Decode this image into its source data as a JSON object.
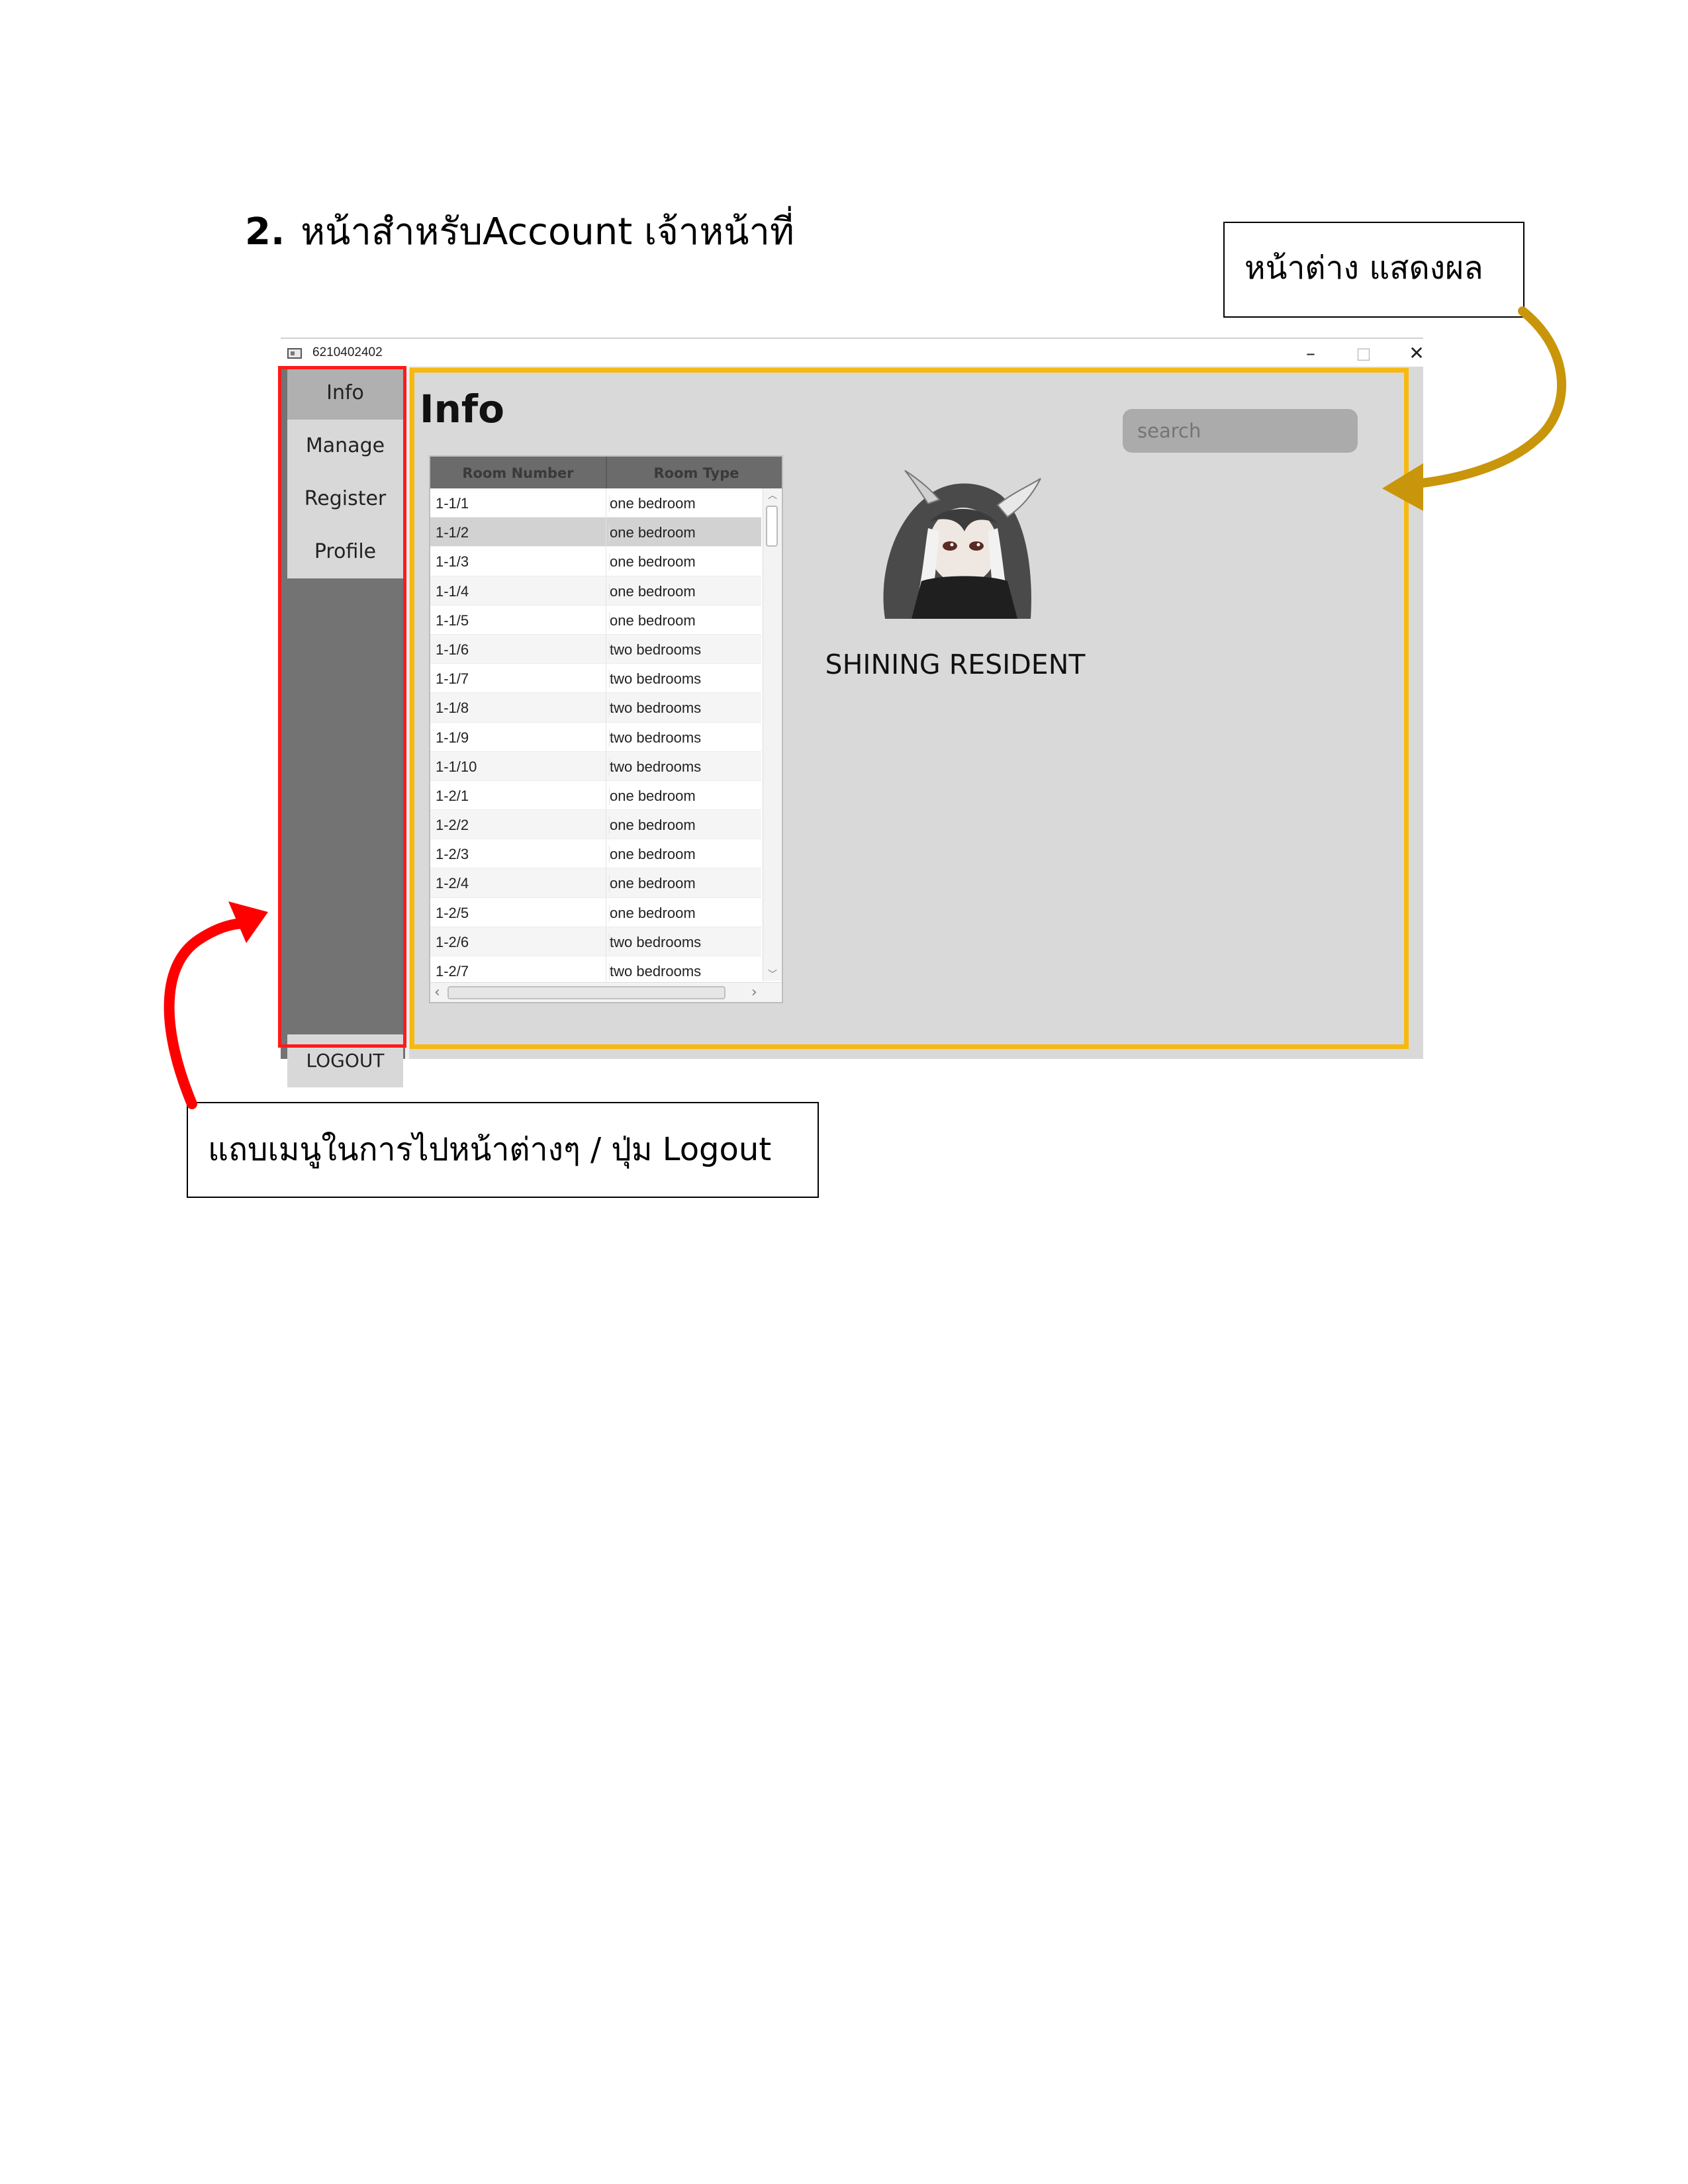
{
  "document": {
    "heading_number": "2.",
    "heading_text": "หน้าสำหรับAccount เจ้าหน้าที่",
    "callout_result_window": "หน้าต่าง แสดงผล",
    "callout_menu_bar": "แถบเมนูในการไปหน้าต่างๆ / ปุ่ม Logout"
  },
  "window": {
    "title": "6210402402",
    "controls": {
      "minimize": "–",
      "maximize": "□",
      "close": "✕"
    }
  },
  "sidebar": {
    "items": [
      {
        "label": "Info",
        "active": true
      },
      {
        "label": "Manage",
        "active": false
      },
      {
        "label": "Register",
        "active": false
      },
      {
        "label": "Profile",
        "active": false
      }
    ],
    "logout_label": "LOGOUT"
  },
  "main": {
    "title": "Info",
    "search": {
      "placeholder": "search",
      "value": ""
    },
    "table": {
      "columns": [
        "Room Number",
        "Room Type"
      ],
      "rows": [
        [
          "1-1/1",
          "one bedroom"
        ],
        [
          "1-1/2",
          "one bedroom"
        ],
        [
          "1-1/3",
          "one bedroom"
        ],
        [
          "1-1/4",
          "one bedroom"
        ],
        [
          "1-1/5",
          "one bedroom"
        ],
        [
          "1-1/6",
          "two bedrooms"
        ],
        [
          "1-1/7",
          "two bedrooms"
        ],
        [
          "1-1/8",
          "two bedrooms"
        ],
        [
          "1-1/9",
          "two bedrooms"
        ],
        [
          "1-1/10",
          "two bedrooms"
        ],
        [
          "1-2/1",
          "one bedroom"
        ],
        [
          "1-2/2",
          "one bedroom"
        ],
        [
          "1-2/3",
          "one bedroom"
        ],
        [
          "1-2/4",
          "one bedroom"
        ],
        [
          "1-2/5",
          "one bedroom"
        ],
        [
          "1-2/6",
          "two bedrooms"
        ],
        [
          "1-2/7",
          "two bedrooms"
        ]
      ],
      "selected_row": 1
    },
    "resident_name": "SHINING RESIDENT"
  },
  "colors": {
    "sidebar_highlight": "#ff1a1a",
    "main_highlight": "#f7b90f",
    "right_arrow": "#c9950a",
    "left_arrow": "#ff0000",
    "sidebar_bg": "#737373",
    "main_bg": "#d9d9d9"
  },
  "icons": [
    "window-app-icon",
    "minimize-icon",
    "maximize-icon",
    "close-icon",
    "avatar-image",
    "scroll-up-icon",
    "scroll-down-icon",
    "scroll-left-icon",
    "scroll-right-icon"
  ]
}
